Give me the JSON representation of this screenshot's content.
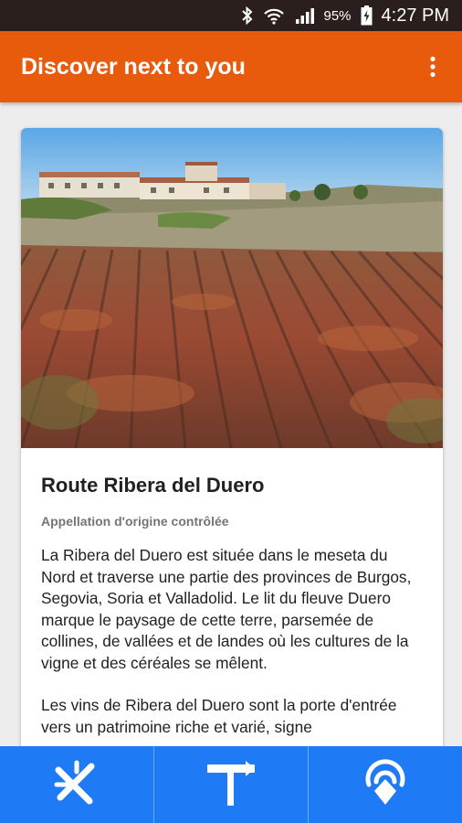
{
  "status_bar": {
    "battery_percent": "95%",
    "time": "4:27 PM",
    "icons": [
      "bluetooth-icon",
      "wifi-icon",
      "signal-icon",
      "battery-charging-icon"
    ]
  },
  "app_bar": {
    "title": "Discover next to you",
    "menu_icon": "more-vert-icon"
  },
  "card": {
    "image_alt": "vineyard-photo",
    "title": "Route Ribera del Duero",
    "subtitle": "Appellation d'origine contrôlée",
    "paragraphs": [
      "La Ribera del Duero est située dans le meseta du Nord et traverse une partie des provinces de Burgos, Segovia, Soria et Valladolid. Le lit du fleuve Duero marque le paysage de cette terre, parsemée de collines, de vallées et de landes où les cultures de la vigne et des céréales se mêlent.",
      "Les vins de Ribera del Duero sont la porte d'entrée vers un patrimoine riche et varié, signe"
    ]
  },
  "bottom_nav": {
    "items": [
      "crossed-tools-icon",
      "signpost-icon",
      "location-pin-icon"
    ]
  },
  "colors": {
    "status_bar": "#2b1f1d",
    "app_bar": "#e85a0c",
    "bottom_nav": "#1e7bf5",
    "background": "#ededed"
  }
}
